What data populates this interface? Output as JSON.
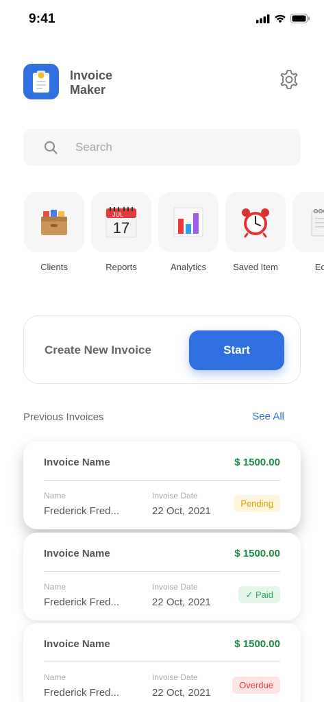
{
  "status_bar": {
    "time": "9:41"
  },
  "app": {
    "title": "Invoice Maker"
  },
  "search": {
    "placeholder": "Search"
  },
  "quick_actions": [
    {
      "label": "Clients",
      "icon": "card-box-icon"
    },
    {
      "label": "Reports",
      "icon": "calendar-icon",
      "month": "JUL",
      "day": "17"
    },
    {
      "label": "Analytics",
      "icon": "bar-chart-icon"
    },
    {
      "label": "Saved Item",
      "icon": "alarm-clock-icon"
    },
    {
      "label": "Edit",
      "icon": "notepad-icon"
    }
  ],
  "create": {
    "label": "Create New Invoice",
    "button": "Start"
  },
  "previous": {
    "title": "Previous Invoices",
    "see_all": "See All"
  },
  "invoices": [
    {
      "name": "Invoice Name",
      "amount": "$ 1500.00",
      "name_label": "Name",
      "client": "Frederick Fred...",
      "date_label": "Invoise Date",
      "date": "22 Oct, 2021",
      "status": "Pending"
    },
    {
      "name": "Invoice Name",
      "amount": "$ 1500.00",
      "name_label": "Name",
      "client": "Frederick Fred...",
      "date_label": "Invoise Date",
      "date": "22 Oct, 2021",
      "status": "✓ Paid"
    },
    {
      "name": "Invoice Name",
      "amount": "$ 1500.00",
      "name_label": "Name",
      "client": "Frederick Fred...",
      "date_label": "Invoise Date",
      "date": "22 Oct, 2021",
      "status": "Overdue"
    }
  ],
  "colors": {
    "accent": "#2f6fe0",
    "amount": "#1d8a4a",
    "pending": "#d9a300",
    "paid": "#2ea35f",
    "overdue": "#e23a3a"
  }
}
